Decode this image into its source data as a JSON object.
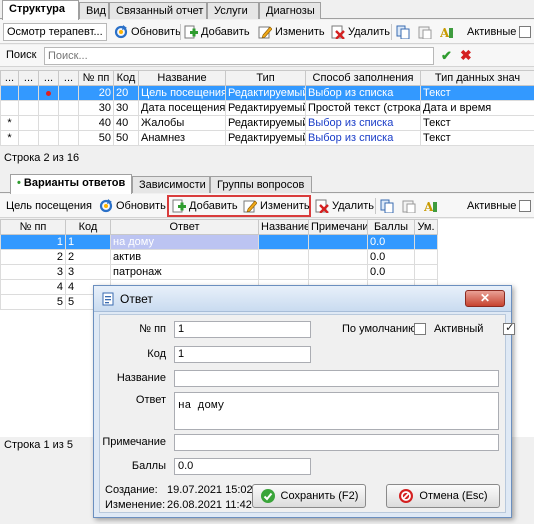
{
  "top_tabs": [
    "Структура",
    "Вид",
    "Связанный отчет",
    "Услуги",
    "Диагнозы"
  ],
  "toolbar1": {
    "combo": "Осмотр терапевт...",
    "refresh": "Обновить",
    "add": "Добавить",
    "edit": "Изменить",
    "delete": "Удалить",
    "active": "Активные"
  },
  "search": {
    "label": "Поиск",
    "placeholder": "Поиск..."
  },
  "grid1": {
    "headers": [
      "...",
      "...",
      "...",
      "...",
      "№ пп",
      "Код",
      "Название",
      "Тип",
      "Способ заполнения",
      "Тип данных знач"
    ],
    "rows": [
      [
        "",
        "",
        "",
        "",
        "20",
        "20",
        "Цель посещения",
        "Редактируемый",
        "Выбор из списка",
        "Текст"
      ],
      [
        "",
        "",
        "",
        "",
        "30",
        "30",
        "Дата посещения",
        "Редактируемый",
        "Простой текст (строка)",
        "Дата и время"
      ],
      [
        "*",
        "",
        "",
        "",
        "40",
        "40",
        "Жалобы",
        "Редактируемый",
        "Выбор из списка",
        "Текст"
      ],
      [
        "*",
        "",
        "",
        "",
        "50",
        "50",
        "Анамнез",
        "Редактируемый",
        "Выбор из списка",
        "Текст"
      ]
    ]
  },
  "status1": "Строка 2 из 16",
  "bottom_tabs": [
    "Варианты ответов",
    "Зависимости",
    "Группы вопросов"
  ],
  "toolbar2": {
    "label": "Цель посещения",
    "refresh": "Обновить",
    "add": "Добавить",
    "edit": "Изменить",
    "delete": "Удалить",
    "active": "Активные"
  },
  "grid2": {
    "headers": [
      "№ пп",
      "Код",
      "Ответ",
      "Название",
      "Примечание",
      "Баллы",
      "Ум."
    ],
    "rows": [
      [
        "1",
        "1",
        "на дому",
        "",
        "",
        "0.0",
        ""
      ],
      [
        "2",
        "2",
        "актив",
        "",
        "",
        "0.0",
        ""
      ],
      [
        "3",
        "3",
        "патронаж",
        "",
        "",
        "0.0",
        ""
      ],
      [
        "4",
        "4",
        "",
        "",
        "",
        "",
        ""
      ],
      [
        "5",
        "5",
        "",
        "",
        "",
        "",
        ""
      ]
    ]
  },
  "status2": "Строка 1 из 5",
  "dialog": {
    "title": "Ответ",
    "num_label": "№ пп",
    "num_value": "1",
    "default_label": "По умолчанию",
    "active_label": "Активный",
    "code_label": "Код",
    "code_value": "1",
    "name_label": "Название",
    "name_value": "",
    "answer_label": "Ответ",
    "answer_value": "на дому",
    "note_label": "Примечание",
    "note_value": "",
    "score_label": "Баллы",
    "score_value": "0.0",
    "created_label": "Создание:",
    "created_value": "19.07.2021 15:02",
    "modified_label": "Изменение:",
    "modified_value": "26.08.2021 11:42",
    "save_label": "Сохранить (F2)",
    "cancel_label": "Отмена (Esc)"
  },
  "colors": {
    "selection": "#3399ff",
    "highlight_border": "#d93c3c",
    "link": "#1a3dc8"
  }
}
